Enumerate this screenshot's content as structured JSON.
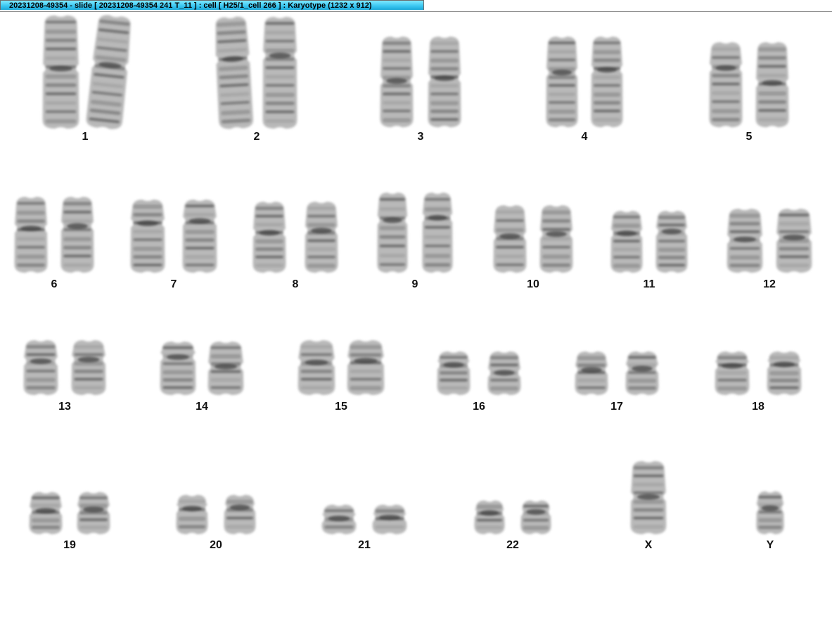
{
  "window": {
    "title": "20231208-49354 - slide [ 20231208-49354 241 T_11 ] : cell [ H25/1_cell 266 ] : Karyotype  (1232 x 912)",
    "accent": "#3dc9f2"
  },
  "karyotype": {
    "labels": [
      "1",
      "2",
      "3",
      "4",
      "5",
      "6",
      "7",
      "8",
      "9",
      "10",
      "11",
      "12",
      "13",
      "14",
      "15",
      "16",
      "17",
      "18",
      "19",
      "20",
      "21",
      "22",
      "X",
      "Y"
    ]
  }
}
